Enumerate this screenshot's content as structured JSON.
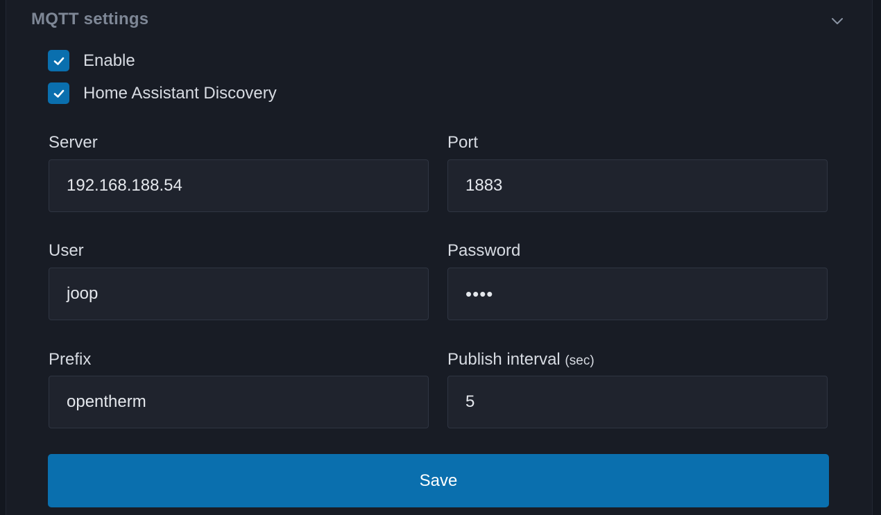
{
  "section": {
    "title": "MQTT settings",
    "collapse_icon": "chevron-down-icon"
  },
  "checkboxes": [
    {
      "label": "Enable",
      "checked": true,
      "icon": "check-icon"
    },
    {
      "label": "Home Assistant Discovery",
      "checked": true,
      "icon": "check-icon"
    }
  ],
  "fields": {
    "server": {
      "label": "Server",
      "value": "192.168.188.54"
    },
    "port": {
      "label": "Port",
      "value": "1883"
    },
    "user": {
      "label": "User",
      "value": "joop"
    },
    "password": {
      "label": "Password",
      "value": "••••"
    },
    "prefix": {
      "label": "Prefix",
      "value": "opentherm"
    },
    "publish_interval": {
      "label": "Publish interval",
      "unit": "(sec)",
      "value": "5"
    }
  },
  "save_button": {
    "label": "Save"
  },
  "colors": {
    "accent": "#0a6fae",
    "background": "#181c25",
    "input_background": "#1f232d",
    "header_text": "#7e8796"
  }
}
